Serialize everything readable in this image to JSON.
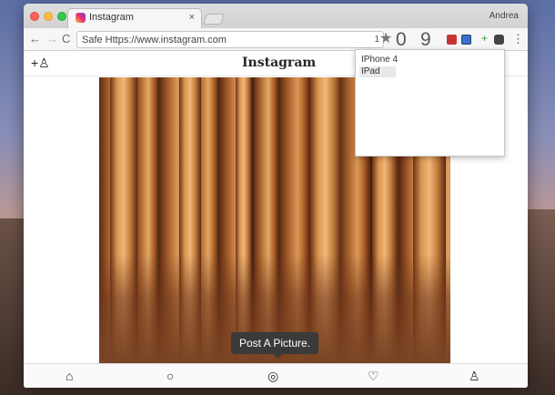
{
  "browser": {
    "tab_title": "Instagram",
    "tab_close": "×",
    "profile_name": "Andrea",
    "address_text": "Safe Https://www.instagram.com",
    "address_suffix": "1",
    "nav_back": "←",
    "nav_forward": "→",
    "nav_reload": "C",
    "star": "★",
    "digit_0": "0",
    "digit_9": "9",
    "ext_plus": "+",
    "menu": "⋮"
  },
  "app": {
    "logo": "Instagram",
    "add_user": "+♙",
    "tooltip": "Post A Picture.",
    "nav": {
      "home": "⌂",
      "search": "○",
      "camera": "◎",
      "heart": "♡",
      "profile": "♙"
    }
  },
  "device_menu": {
    "items": [
      "IPhone 4",
      "IPad"
    ]
  },
  "colors": {
    "accent": "#262626",
    "tooltip_bg": "#3a3a3a"
  }
}
